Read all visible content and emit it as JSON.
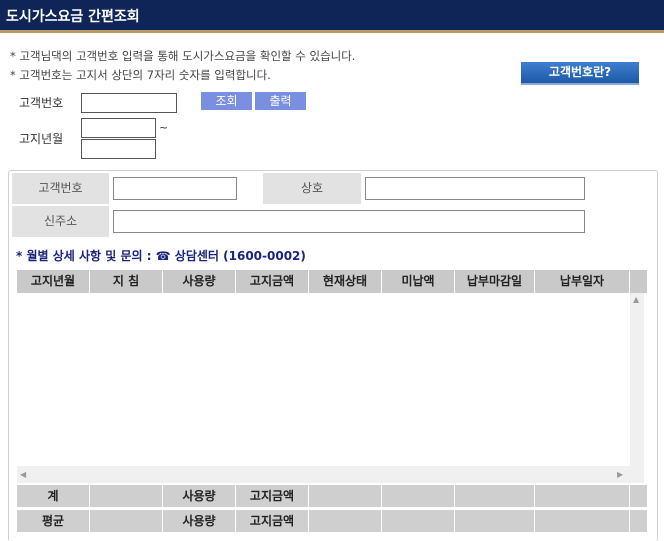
{
  "header": {
    "title": "도시가스요금 간편조회"
  },
  "notes": [
    "* 고객님댁의 고객번호 입력을 통해 도시가스요금을 확인할 수 있습니다.",
    "* 고객번호는 고지서 상단의 7자리 숫자를 입력합니다."
  ],
  "help_button": "고객번호란?",
  "search": {
    "customer_no_label": "고객번호",
    "billing_month_label": "고지년월",
    "range_separator": "~",
    "customer_no_value": "",
    "month_from_value": "",
    "month_to_value": "",
    "query_button": "조회",
    "print_button": "출력"
  },
  "detail": {
    "customer_no_label": "고객번호",
    "customer_no_value": "",
    "company_label": "상호",
    "company_value": "",
    "address_label": "신주소",
    "address_value": ""
  },
  "info_line": "* 월별 상세 사항 및 문의 : ☎ 상담센터 (1600-0002)",
  "table": {
    "columns": [
      "고지년월",
      "지 침",
      "사용량",
      "고지금액",
      "현재상태",
      "미납액",
      "납부마감일",
      "납부일자"
    ],
    "rows": []
  },
  "footer": {
    "total": {
      "label": "계",
      "usage": "사용량",
      "amount": "고지금액"
    },
    "average": {
      "label": "평균",
      "usage": "사용량",
      "amount": "고지금액"
    }
  },
  "colors": {
    "title_bg": "#0f2557",
    "accent": "#b89a6a",
    "button": "#7a8fe0",
    "help_button": "#1d5aa8"
  }
}
